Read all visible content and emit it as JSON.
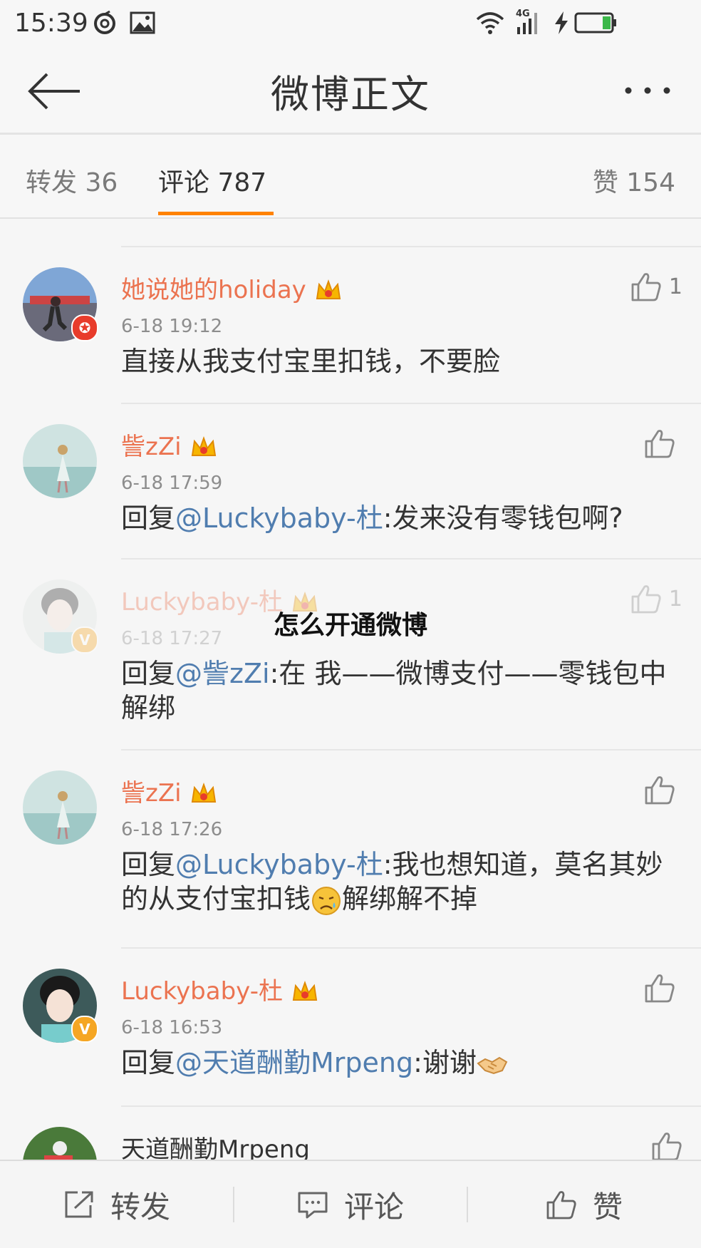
{
  "status": {
    "time": "15:39",
    "network": "4G"
  },
  "nav": {
    "title": "微博正文"
  },
  "tabs": {
    "repost": "转发 36",
    "comments": "评论 787",
    "likes": "赞 154"
  },
  "comments": [
    {
      "user": "她说她的holiday",
      "time": "6-18 19:12",
      "text": "直接从我支付宝里扣钱，不要脸",
      "likes": "1"
    },
    {
      "user": "訾zZi",
      "time": "6-18 17:59",
      "prefix": "回复",
      "mention": "@Luckybaby-杜",
      "text": ":发来没有零钱包啊?",
      "likes": ""
    },
    {
      "user": "Luckybaby-杜",
      "time": "6-18 17:27",
      "prefix": "回复",
      "mention": "@訾zZi",
      "text": ":在 我——微博支付——零钱包中解绑",
      "likes": "1"
    },
    {
      "user": "訾zZi",
      "time": "6-18 17:26",
      "prefix": "回复",
      "mention": "@Luckybaby-杜",
      "text": ":我也想知道，莫名其妙的从支付宝扣钱",
      "text2": "解绑解不掉",
      "likes": ""
    },
    {
      "user": "Luckybaby-杜",
      "time": "6-18 16:53",
      "prefix": "回复",
      "mention": "@天道酬勤Mrpeng",
      "text": ":谢谢",
      "likes": ""
    },
    {
      "user": "天道酬勤Mrpeng",
      "likes": ""
    }
  ],
  "overlay": {
    "title": "怎么开通微博"
  },
  "bottom": {
    "repost": "转发",
    "comment": "评论",
    "like": "赞"
  },
  "colors": {
    "accent": "#ff8200",
    "username": "#eb7350",
    "mention": "#507daf"
  }
}
